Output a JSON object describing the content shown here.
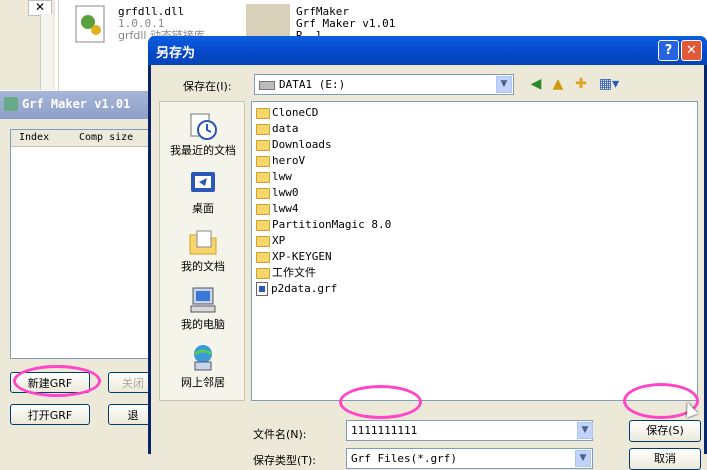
{
  "background": {
    "close_glyph": "✕",
    "files": [
      {
        "name": "grfdll.dll",
        "version": "1.0.0.1",
        "desc": "grfdll 动态链接库"
      },
      {
        "name": "GrfMaker",
        "version": "Grf Maker v1.01",
        "desc": "R..l"
      }
    ]
  },
  "grf_maker": {
    "title": "Grf Maker v1.01",
    "columns": [
      "Index",
      "Comp size"
    ],
    "buttons": {
      "new": "新建GRF",
      "close": "关闭",
      "open": "打开GRF",
      "exit": "退"
    }
  },
  "dialog": {
    "title": "另存为",
    "help_glyph": "?",
    "close_glyph": "✕",
    "save_in_label": "保存在(I):",
    "save_in_value": "DATA1 (E:)",
    "toolbar_icons": [
      "back-icon",
      "up-folder-icon",
      "new-folder-icon",
      "view-menu-icon"
    ],
    "places": [
      {
        "label": "我最近的文档",
        "icon": "recent-documents-icon"
      },
      {
        "label": "桌面",
        "icon": "desktop-icon"
      },
      {
        "label": "我的文档",
        "icon": "my-documents-icon"
      },
      {
        "label": "我的电脑",
        "icon": "my-computer-icon"
      },
      {
        "label": "网上邻居",
        "icon": "network-places-icon"
      }
    ],
    "items": [
      {
        "name": "CloneCD",
        "type": "folder"
      },
      {
        "name": "data",
        "type": "folder"
      },
      {
        "name": "Downloads",
        "type": "folder"
      },
      {
        "name": "heroV",
        "type": "folder"
      },
      {
        "name": "lww",
        "type": "folder"
      },
      {
        "name": "lww0",
        "type": "folder"
      },
      {
        "name": "lww4",
        "type": "folder"
      },
      {
        "name": "PartitionMagic 8.0",
        "type": "folder"
      },
      {
        "name": "XP",
        "type": "folder"
      },
      {
        "name": "XP-KEYGEN",
        "type": "folder"
      },
      {
        "name": "工作文件",
        "type": "folder"
      },
      {
        "name": "p2data.grf",
        "type": "grf-file"
      }
    ],
    "filename_label": "文件名(N):",
    "filename_value": "1111111111",
    "filetype_label": "保存类型(T):",
    "filetype_value": "Grf Files(*.grf)",
    "save_button": "保存(S)",
    "cancel_button": "取消"
  }
}
